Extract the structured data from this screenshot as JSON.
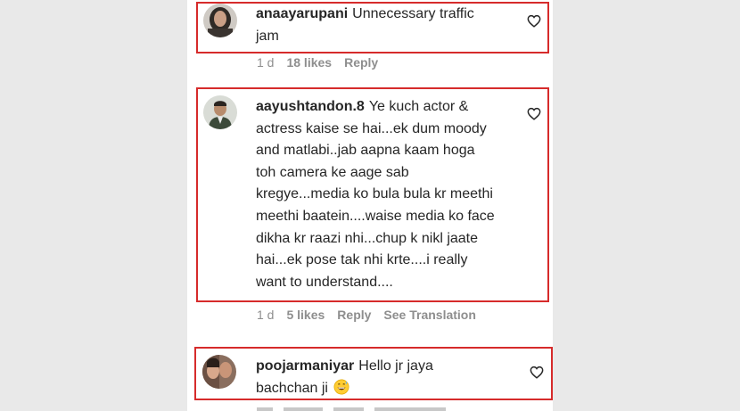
{
  "comments": [
    {
      "username": "anaayarupani",
      "text": "Unnecessary traffic jam",
      "time": "1 d",
      "likes": "18 likes",
      "reply": "Reply",
      "see_translation": ""
    },
    {
      "username": "aayushtandon.8",
      "text": "Ye kuch actor & actress kaise se hai...ek dum moody and matlabi..jab aapna kaam hoga toh camera ke aage sab kregye...media ko bula bula kr meethi meethi baatein....waise media ko face dikha kr raazi nhi...chup k nikl jaate hai...ek pose tak nhi krte....i really want to understand....",
      "time": "1 d",
      "likes": "5 likes",
      "reply": "Reply",
      "see_translation": "See Translation"
    },
    {
      "username": "poojarmaniyar",
      "text": "Hello jr jaya bachchan ji",
      "emoji": "grinning-sweat-emoji"
    }
  ],
  "colors": {
    "highlight_border": "#d62b2b",
    "meta_text": "#8e8e8e",
    "body_text": "#262626"
  }
}
